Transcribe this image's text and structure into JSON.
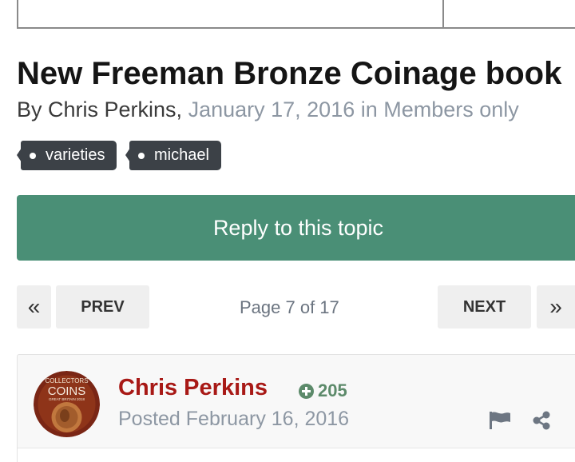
{
  "topic": {
    "title": "New Freeman Bronze Coinage book",
    "by_prefix": "By Chris Perkins,",
    "date_in": "January 17, 2016 in Members only"
  },
  "tags": [
    "varieties",
    "michael"
  ],
  "reply_button": "Reply to this topic",
  "pagination": {
    "first_icon": "«",
    "prev": "PREV",
    "page_text": "Page 7 of 17",
    "next": "NEXT",
    "last_icon": "»"
  },
  "post": {
    "author": "Chris Perkins",
    "reputation": "205",
    "posted": "Posted February 16, 2016",
    "avatar_text": {
      "line1": "COLLECTORS",
      "line2": "COINS",
      "line3": "GREAT BRITAIN 2018"
    }
  },
  "colors": {
    "reply_button": "#4a8f76",
    "tag_bg": "#3c4147",
    "author": "#a81916",
    "muted": "#8d97a3",
    "reputation": "#5c8a6a"
  },
  "icons": [
    "flag-icon",
    "share-icon",
    "plus-circle-icon"
  ]
}
